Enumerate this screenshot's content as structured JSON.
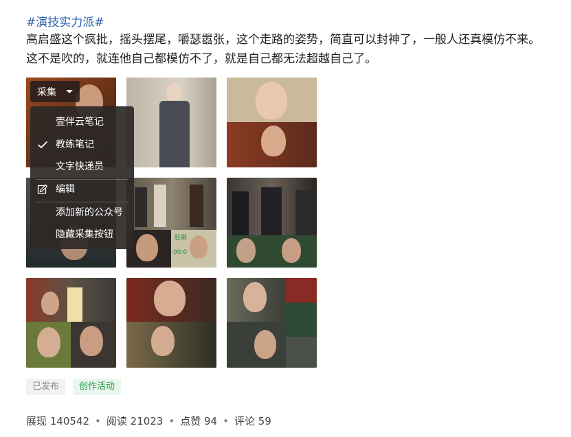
{
  "post": {
    "hashtag": "#演技实力派#",
    "line1": "高启盛这个疯批，摇头摆尾，嚼瑟嚣张，这个走路的姿势，简直可以封神了，一般人还真模仿不来。",
    "line2": "这不是吹的，就连他自己都模仿不了，就是自己都无法超越自己了。"
  },
  "collect_button": {
    "label": "采集"
  },
  "collect_menu": {
    "items": [
      {
        "label": "壹伴云笔记",
        "icon": "none"
      },
      {
        "label": "教练笔记",
        "icon": "check-icon"
      },
      {
        "label": "文字快递员",
        "icon": "none"
      },
      {
        "label": "编辑",
        "icon": "edit-icon"
      },
      {
        "label": "添加新的公众号",
        "icon": "none"
      },
      {
        "label": "隐藏采集按钮",
        "icon": "none"
      }
    ]
  },
  "image_tile_mini_text": {
    "a": "狂飙",
    "b": "00:0"
  },
  "tags": [
    {
      "label": "已发布",
      "color": "#888888",
      "bg": "#f2f2f2"
    },
    {
      "label": "创作活动",
      "color": "#2e9a4f",
      "bg": "#e9f6ec"
    }
  ],
  "stats": {
    "views": "展现 140542",
    "reads": "阅读 21023",
    "likes": "点赞 94",
    "comments": "评论 59"
  }
}
